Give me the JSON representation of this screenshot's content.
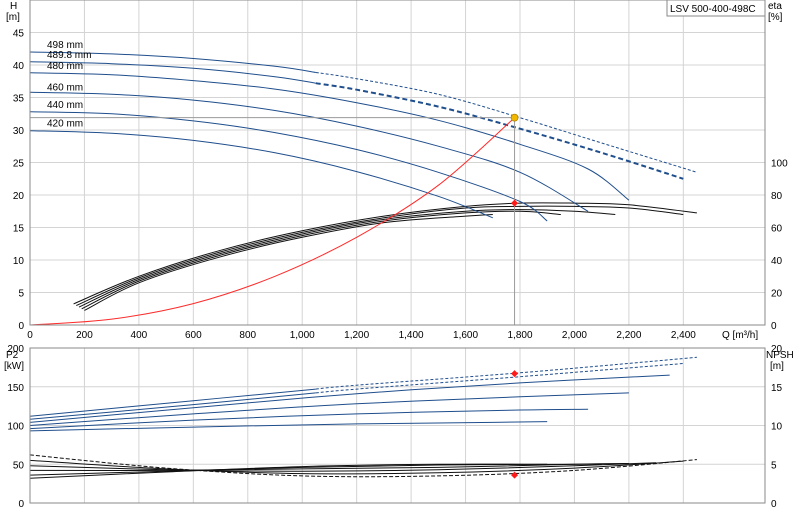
{
  "chart_data": {
    "model_label": "LSV 500-400-498C",
    "panels": {
      "top": {
        "type": "line",
        "y_left_label": "H",
        "y_left_unit": "[m]",
        "y_right_label": "eta",
        "y_right_unit": "[%]",
        "x_label": "Q [m³/h]",
        "xlim": [
          0,
          2700
        ],
        "ylim_left": [
          0,
          50
        ],
        "x_ticks": [
          0,
          200,
          400,
          600,
          800,
          1000,
          1200,
          1400,
          1600,
          1800,
          2000,
          2200,
          2400
        ],
        "x_tick_labels": [
          "0",
          "200",
          "400",
          "600",
          "800",
          "1,000",
          "1,200",
          "1,400",
          "1,600",
          "1,800",
          "2,000",
          "2,200",
          "2,400"
        ],
        "y_left_ticks": [
          0,
          5,
          10,
          15,
          20,
          25,
          30,
          35,
          40,
          45
        ],
        "y_right_ticks": [
          0,
          20,
          40,
          60,
          80,
          100
        ],
        "eta_axis_top_at_H": 25,
        "head_curves": [
          {
            "label": "498 mm",
            "q": [
              0,
              300,
              600,
              900,
              1200,
              1500,
              1800,
              2100,
              2450
            ],
            "h": [
              42,
              41.7,
              41.0,
              39.8,
              37.9,
              35.5,
              31.9,
              28.0,
              23.5
            ],
            "dashed_from": 1050
          },
          {
            "label": "489.8 mm",
            "q": [
              0,
              300,
              600,
              900,
              1200,
              1500,
              1800,
              2100,
              2400
            ],
            "h": [
              40.5,
              40.2,
              39.5,
              38.2,
              36.2,
              33.6,
              30.2,
              26.5,
              22.5
            ],
            "dashed_from": 1050
          },
          {
            "label": "480 mm",
            "q": [
              0,
              300,
              600,
              900,
              1200,
              1500,
              1800,
              2050,
              2200
            ],
            "h": [
              38.8,
              38.5,
              37.6,
              36.3,
              34.2,
              31.5,
              27.8,
              24.0,
              19.2
            ]
          },
          {
            "label": "460 mm",
            "q": [
              0,
              300,
              600,
              900,
              1200,
              1500,
              1800,
              2050
            ],
            "h": [
              35.8,
              35.5,
              34.6,
              33.0,
              30.6,
              27.5,
              23.5,
              17.5
            ]
          },
          {
            "label": "440 mm",
            "q": [
              0,
              300,
              600,
              900,
              1200,
              1500,
              1800,
              1900
            ],
            "h": [
              32.8,
              32.5,
              31.4,
              29.6,
              27.0,
              23.5,
              19.0,
              16.0
            ]
          },
          {
            "label": "420 mm",
            "q": [
              0,
              300,
              600,
              900,
              1200,
              1500,
              1700
            ],
            "h": [
              29.9,
              29.5,
              28.4,
              26.5,
              23.6,
              19.8,
              16.5
            ]
          }
        ],
        "efficiency_curves": [
          {
            "q": [
              160,
              400,
              700,
              1000,
              1300,
              1600,
              1800,
              2000,
              2200,
              2450
            ],
            "eta": [
              13,
              30,
              46,
              58,
              67,
              73,
              75,
              75,
              74,
              69
            ]
          },
          {
            "q": [
              170,
              400,
              700,
              1000,
              1300,
              1600,
              1800,
              2000,
              2200,
              2400
            ],
            "eta": [
              12,
              29,
              45,
              57,
              66,
              72,
              73,
              73,
              72,
              68
            ]
          },
          {
            "q": [
              180,
              400,
              700,
              1000,
              1300,
              1600,
              1800,
              2000,
              2150
            ],
            "eta": [
              11,
              28,
              44,
              56,
              65,
              70,
              71,
              70,
              68
            ]
          },
          {
            "q": [
              190,
              400,
              700,
              1000,
              1300,
              1600,
              1800,
              1950
            ],
            "eta": [
              10,
              27,
              43,
              55,
              64,
              69,
              70,
              68
            ]
          },
          {
            "q": [
              200,
              400,
              700,
              1000,
              1300,
              1600,
              1700
            ],
            "eta": [
              9,
              26,
              42,
              54,
              63,
              67,
              68
            ]
          }
        ],
        "system_curve": {
          "q": [
            0,
            300,
            600,
            900,
            1200,
            1500,
            1780
          ],
          "h": [
            0,
            0.9,
            3.3,
            7.5,
            13.5,
            21.5,
            31.9
          ]
        },
        "duty_point": {
          "q": 1780,
          "h": 31.9
        },
        "efficiency_point": {
          "q": 1780,
          "eta": 75
        }
      },
      "bottom": {
        "type": "line",
        "y_left_label": "P2",
        "y_left_unit": "[kW]",
        "y_right_label": "NPSH",
        "y_right_unit": "[m]",
        "ylim_left": [
          0,
          200
        ],
        "ylim_right": [
          0,
          20
        ],
        "y_left_ticks": [
          0,
          50,
          100,
          150,
          200
        ],
        "y_right_ticks": [
          0,
          5,
          10,
          15,
          20
        ],
        "power_curves": [
          {
            "q": [
              0,
              600,
              1200,
              1800,
              2450
            ],
            "p2": [
              112,
              132,
              152,
              168,
              188
            ],
            "dashed_from": 1050
          },
          {
            "q": [
              0,
              600,
              1200,
              1800,
              2400
            ],
            "p2": [
              108,
              127,
              147,
              163,
              180
            ],
            "dashed_from": 1050
          },
          {
            "q": [
              0,
              600,
              1200,
              1800,
              2350
            ],
            "p2": [
              104,
              123,
              141,
              155,
              165
            ]
          },
          {
            "q": [
              0,
              600,
              1200,
              1800,
              2200
            ],
            "p2": [
              100,
              115,
              128,
              137,
              142
            ]
          },
          {
            "q": [
              0,
              600,
              1200,
              1800,
              2050
            ],
            "p2": [
              96,
              107,
              115,
              120,
              121
            ]
          },
          {
            "q": [
              0,
              600,
              1200,
              1700,
              1900
            ],
            "p2": [
              93,
              98,
              102,
              104,
              105
            ]
          }
        ],
        "npsh_curves": [
          {
            "q": [
              0,
              500,
              1000,
              1500,
              2000,
              2450
            ],
            "npsh": [
              6.2,
              4.5,
              3.5,
              3.5,
              4.2,
              5.6
            ]
          },
          {
            "q": [
              0,
              500,
              1000,
              1500,
              2000,
              2400
            ],
            "npsh": [
              5.5,
              4.4,
              3.8,
              3.9,
              4.5,
              5.4
            ]
          },
          {
            "q": [
              0,
              500,
              1000,
              1500,
              2000,
              2300
            ],
            "npsh": [
              4.8,
              4.3,
              4.1,
              4.3,
              4.8,
              5.2
            ]
          },
          {
            "q": [
              0,
              500,
              1000,
              1500,
              2000,
              2200
            ],
            "npsh": [
              4.2,
              4.2,
              4.4,
              4.6,
              5.0,
              5.1
            ]
          },
          {
            "q": [
              0,
              500,
              1000,
              1500,
              2000,
              2100
            ],
            "npsh": [
              3.6,
              4.1,
              4.6,
              4.9,
              5.0,
              5.0
            ]
          },
          {
            "q": [
              0,
              500,
              1000,
              1500,
              1900
            ],
            "npsh": [
              3.2,
              4.0,
              4.7,
              5.0,
              5.0
            ]
          }
        ],
        "power_point": {
          "q": 1780,
          "p2": 167
        },
        "npsh_point": {
          "q": 1780,
          "npsh": 3.6
        }
      }
    },
    "colors": {
      "head": "#1f4e8c",
      "efficiency": "#111111",
      "system": "#ff2a2a",
      "duty_point": "#f2b800",
      "marker": "#ff1a1a",
      "grid": "#d4d4d4",
      "crosshair": "#9a9a9a"
    }
  }
}
